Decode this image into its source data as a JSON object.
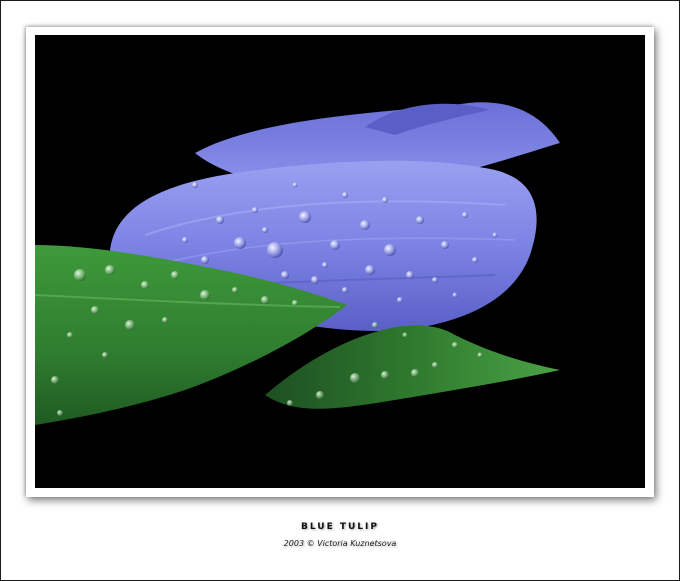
{
  "caption": {
    "title": "BLUE TULIP",
    "credit": "2003 © Victoria Kuznetsova"
  },
  "colors": {
    "background": "#000000",
    "petal": "#7f86e6",
    "leaf": "#3f9a3c",
    "mat": "#ffffff"
  }
}
